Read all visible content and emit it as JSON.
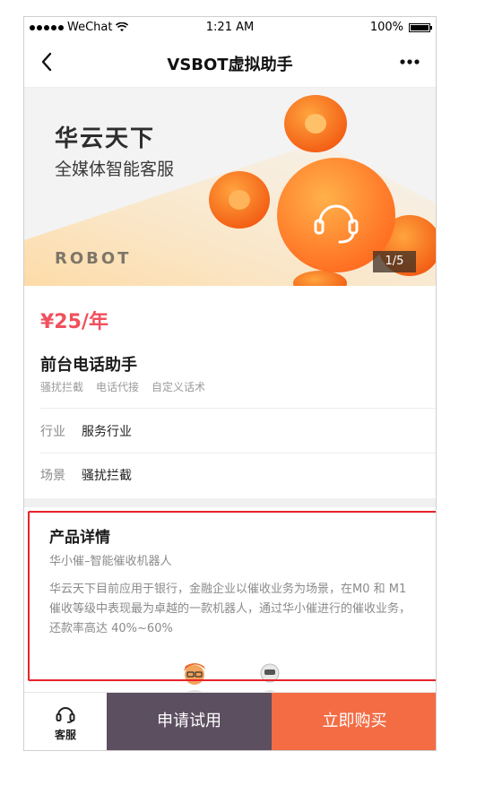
{
  "status_bar": {
    "carrier": "WeChat",
    "time": "1:21 AM",
    "battery": "100%"
  },
  "nav": {
    "title": "VSBOT虚拟助手"
  },
  "banner": {
    "title": "华云天下",
    "subtitle": "全媒体智能客服",
    "watermark": "ROBOT",
    "pager": "1/5"
  },
  "product": {
    "price": "¥25/年",
    "name": "前台电话助手",
    "tags": [
      "骚扰拦截",
      "电话代接",
      "自定义话术"
    ],
    "industry_label": "行业",
    "industry_value": "服务行业",
    "scene_label": "场景",
    "scene_value": "骚扰拦截"
  },
  "details": {
    "title": "产品详情",
    "subtitle": "华小催–智能催收机器人",
    "body": "华云天下目前应用于银行，金融企业以催收业务为场景，在M0 和 M1 催收等级中表现最为卓越的一款机器人，通过华小催进行的催收业务，还款率高达 40%~60%"
  },
  "bottom_bar": {
    "service_label": "客服",
    "trial_label": "申请试用",
    "buy_label": "立即购买"
  },
  "colors": {
    "price": "#f1505c",
    "trial_button": "#5c4f60",
    "buy_button": "#f36c44",
    "highlight_border": "#e8232a"
  }
}
